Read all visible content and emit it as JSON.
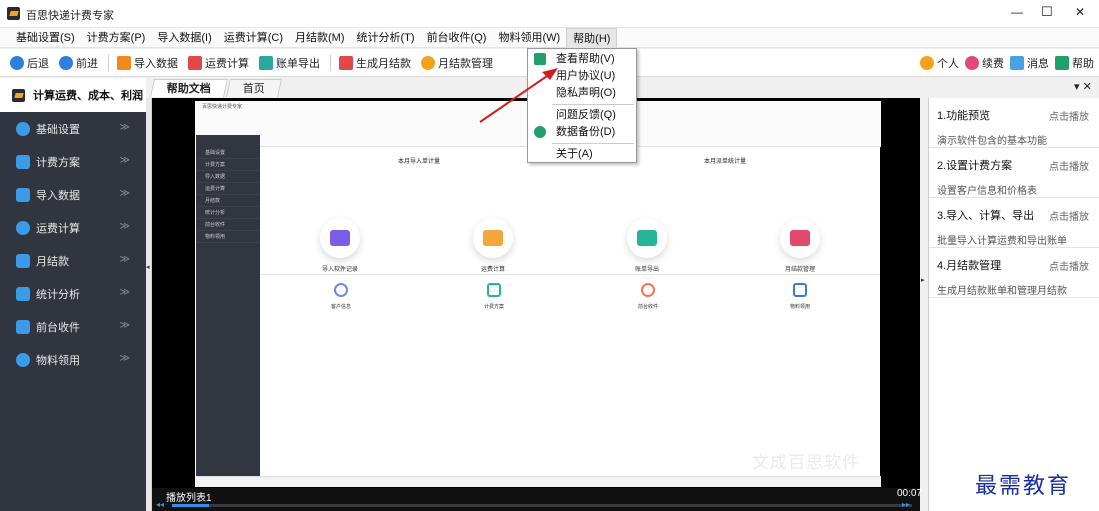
{
  "window": {
    "title": "百思快递计费专家",
    "minimize": "—",
    "maximize": "☐",
    "close": "✕"
  },
  "menu": [
    "基础设置(S)",
    "计费方案(P)",
    "导入数据(I)",
    "运费计算(C)",
    "月结款(M)",
    "统计分析(T)",
    "前台收件(Q)",
    "物料领用(W)",
    "帮助(H)"
  ],
  "toolbar": {
    "back": "后退",
    "forward": "前进",
    "import": "导入数据",
    "calc": "运费计算",
    "export": "账单导出",
    "monthly": "生成月结款",
    "monthly_mgr": "月结款管理",
    "personal": "个人",
    "renew": "续费",
    "message": "消息",
    "help": "帮助"
  },
  "sidebar": {
    "header": "计算运费、成本、利润",
    "items": [
      "基础设置",
      "计费方案",
      "导入数据",
      "运费计算",
      "月结款",
      "统计分析",
      "前台收件",
      "物料领用"
    ]
  },
  "tabs": [
    "帮助文档",
    "首页"
  ],
  "help_menu": [
    "查看帮助(V)",
    "用户协议(U)",
    "隐私声明(O)",
    "问题反馈(Q)",
    "数据备份(D)",
    "关于(A)"
  ],
  "right_panel": [
    {
      "title": "1.功能预览",
      "play": "点击播放",
      "desc": "演示软件包含的基本功能"
    },
    {
      "title": "2.设置计费方案",
      "play": "点击播放",
      "desc": "设置客户信息和价格表"
    },
    {
      "title": "3.导入、计算、导出",
      "play": "点击播放",
      "desc": "批量导入计算运费和导出账单"
    },
    {
      "title": "4.月结款管理",
      "play": "点击播放",
      "desc": "生成月结款账单和管理月结款"
    }
  ],
  "video": {
    "playlist": "播放列表1",
    "time": "00:07",
    "watermark": "文成百思软件",
    "progress": 0.05
  },
  "inner_app": {
    "title": "百思快递计费专家",
    "stat_left": "本月导入单计量",
    "stat_right": "本月派单统计量",
    "cards": [
      "导入软件记录",
      "运费计算",
      "账单导出",
      "月结款管理"
    ],
    "small_cards": [
      "客户信息",
      "计费方案",
      "前台收件",
      "物料领用"
    ]
  },
  "site_watermark": "最需教育"
}
